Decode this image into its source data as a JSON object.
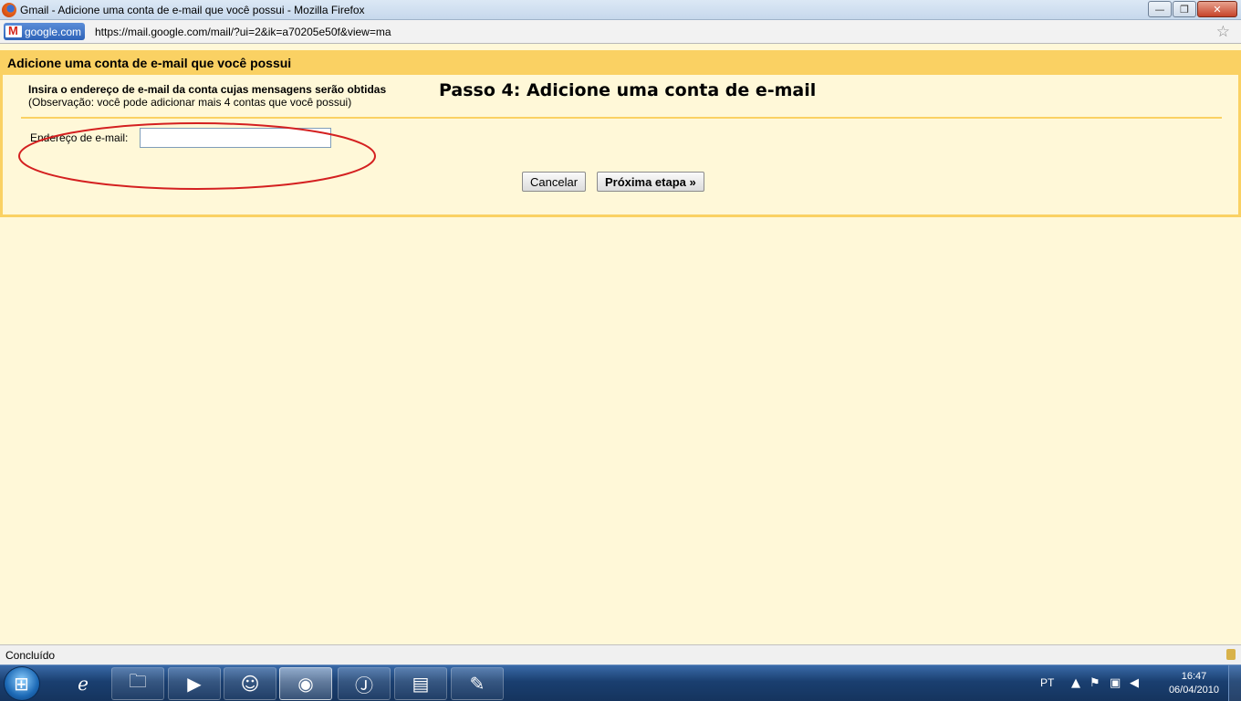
{
  "window": {
    "title": "Gmail - Adicione uma conta de e-mail que você possui - Mozilla Firefox",
    "controls": {
      "minimize": "—",
      "restore": "❐",
      "close": "✕"
    }
  },
  "addressbar": {
    "site_label": "google.com",
    "url": "https://mail.google.com/mail/?ui=2&ik=a70205e50f&view=ma"
  },
  "dialog": {
    "header": "Adicione uma conta de e-mail que você possui",
    "instruction": "Insira o endereço de e-mail da conta cujas mensagens serão obtidas",
    "note": "(Observação: você pode adicionar mais 4 contas que você possui)",
    "step_title": "Passo 4: Adicione uma conta de e-mail",
    "email_label": "Endereço de e-mail:",
    "email_value": "",
    "cancel_label": "Cancelar",
    "next_label": "Próxima etapa »"
  },
  "statusbar": {
    "text": "Concluído"
  },
  "taskbar": {
    "language": "PT",
    "time": "16:47",
    "date": "06/04/2010"
  },
  "colors": {
    "panel_border": "#fad163",
    "panel_bg": "#fff8d8",
    "highlight_ellipse": "#d42020"
  }
}
